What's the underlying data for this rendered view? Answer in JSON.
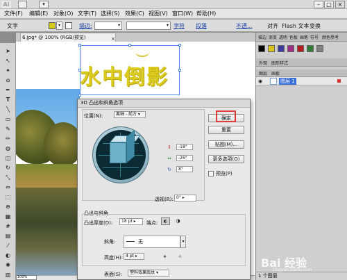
{
  "app": {
    "logo": "Ai",
    "window_buttons": {
      "minimize": "–",
      "maximize": "□",
      "close": "×"
    }
  },
  "menu": [
    "文件(F)",
    "编辑(E)",
    "对象(O)",
    "文字(T)",
    "选择(S)",
    "效果(C)",
    "视图(V)",
    "窗口(W)",
    "帮助(H)"
  ],
  "control_bar": {
    "tool_label": "文字",
    "fill_color": "#d8c81e",
    "stroke_label": "描边:",
    "char_label": "字符",
    "para_label": "段落",
    "opacity_label": "不透...",
    "align_label": "对齐",
    "flash_text_label": "Flash 文本",
    "transform_label": "变换"
  },
  "document": {
    "tab_title": "6.jpg* @ 100% (RGB/预览)",
    "tab_close": "×",
    "zoom": "100%",
    "art_text": "水中倒影"
  },
  "panels": {
    "swatch_tabs": [
      "描边",
      "渐变",
      "透明",
      "色板",
      "画笔",
      "符号",
      "颜色参考"
    ],
    "swatch_colors": [
      "#000000",
      "#d8c81e",
      "#3c3c9a",
      "#9e2f86",
      "#b31d1d",
      "#2f7f3a",
      "#808080"
    ],
    "appearance_tabs": [
      "外观",
      "图形样式"
    ],
    "layer_tabs": [
      "图层",
      "画板"
    ],
    "layer_name": "图层 1",
    "layer_count": "1 个图层"
  },
  "dialog": {
    "title": "3D 凸出和斜角选项",
    "position_label": "位置(N):",
    "position_value": "离轴 - 前方",
    "rot_x": "-18°",
    "rot_y": "-26°",
    "rot_z": "8°",
    "perspective_label": "透视(R):",
    "perspective_value": "0°",
    "btn_ok": "确定",
    "btn_reset": "重置",
    "btn_map": "贴图(M)...",
    "btn_more": "更多选项(O)",
    "preview_label": "预览(P)",
    "extrude_section": "凸出与斜角",
    "depth_label": "凸出厚度(D):",
    "depth_value": "18 pt",
    "cap_label": "端点:",
    "bevel_label": "斜角:",
    "bevel_value": "无",
    "height_label": "高度(H):",
    "height_value": "4 pt",
    "surface_label": "表面(S):",
    "surface_value": "塑料效果底纹"
  },
  "watermark": {
    "logo": "Bai 经验",
    "sub": "jingyan.baidu.com"
  }
}
